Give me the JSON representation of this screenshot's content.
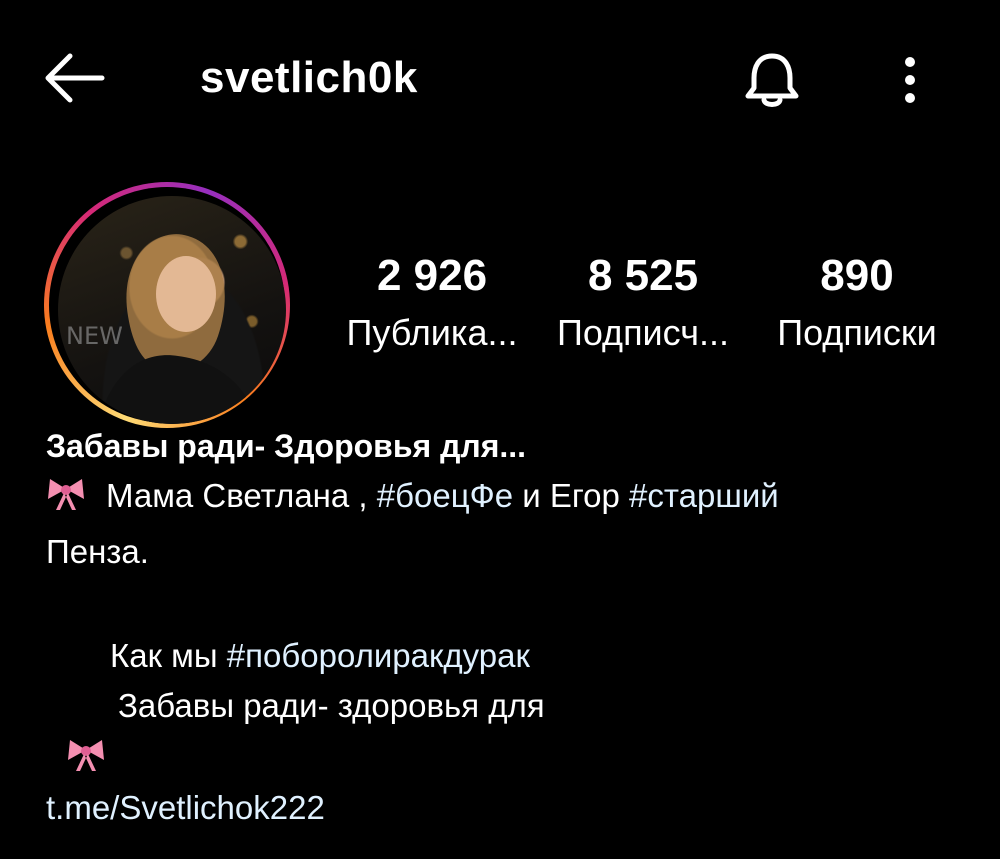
{
  "header": {
    "username": "svetlich0k",
    "icons": {
      "back": "arrow-left-icon",
      "bell": "bell-icon",
      "more": "more-vertical-icon"
    }
  },
  "stats": [
    {
      "value": "2 926",
      "label": "Публика..."
    },
    {
      "value": "8 525",
      "label": "Подписч..."
    },
    {
      "value": "890",
      "label": "Подписки"
    }
  ],
  "bio": {
    "name": "Забавы ради- Здоровья для...",
    "line1_text": "Мама Светлана , ",
    "line1_tag1": "#боецФе",
    "line1_mid": " и Егор ",
    "line1_tag2": "#старший",
    "line2": "Пенза.",
    "line3_text": "Как мы ",
    "line3_tag": "#поборолиракдурак",
    "line4": "Забавы ради- здоровья для",
    "link": "t.me/Svetlichok222",
    "emoji": "ribbon-bow-icon"
  },
  "colors": {
    "background": "#000000",
    "text": "#ffffff",
    "link": "#e0f1ff",
    "bow": "#f48fb1"
  }
}
